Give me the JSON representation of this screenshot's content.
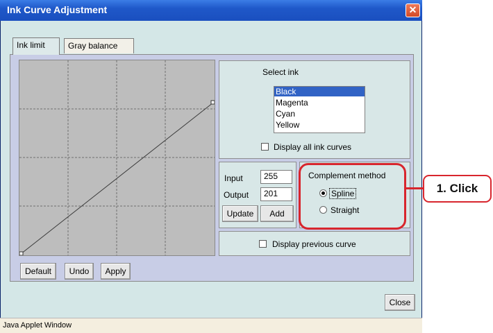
{
  "window": {
    "title": "Ink Curve Adjustment",
    "close_glyph": "✕"
  },
  "tabs": [
    {
      "label": "Ink limit",
      "active": true
    },
    {
      "label": "Gray balance",
      "active": false
    }
  ],
  "ink_select": {
    "label": "Select ink",
    "items": [
      "Black",
      "Magenta",
      "Cyan",
      "Yellow"
    ],
    "selected": "Black",
    "display_all_label": "Display all ink curves"
  },
  "io": {
    "input_label": "Input",
    "input_value": "255",
    "output_label": "Output",
    "output_value": "201",
    "update_label": "Update",
    "add_label": "Add"
  },
  "complement": {
    "title": "Complement method",
    "spline_label": "Spline",
    "straight_label": "Straight",
    "selected": "Spline"
  },
  "previous_curve_label": "Display previous curve",
  "buttons": {
    "default": "Default",
    "undo": "Undo",
    "apply": "Apply",
    "close": "Close"
  },
  "status": "Java Applet Window",
  "callout": "1. Click",
  "colors": {
    "title_bar": "#1f58c9",
    "highlight": "#d8252d",
    "selection": "#3163c5"
  }
}
